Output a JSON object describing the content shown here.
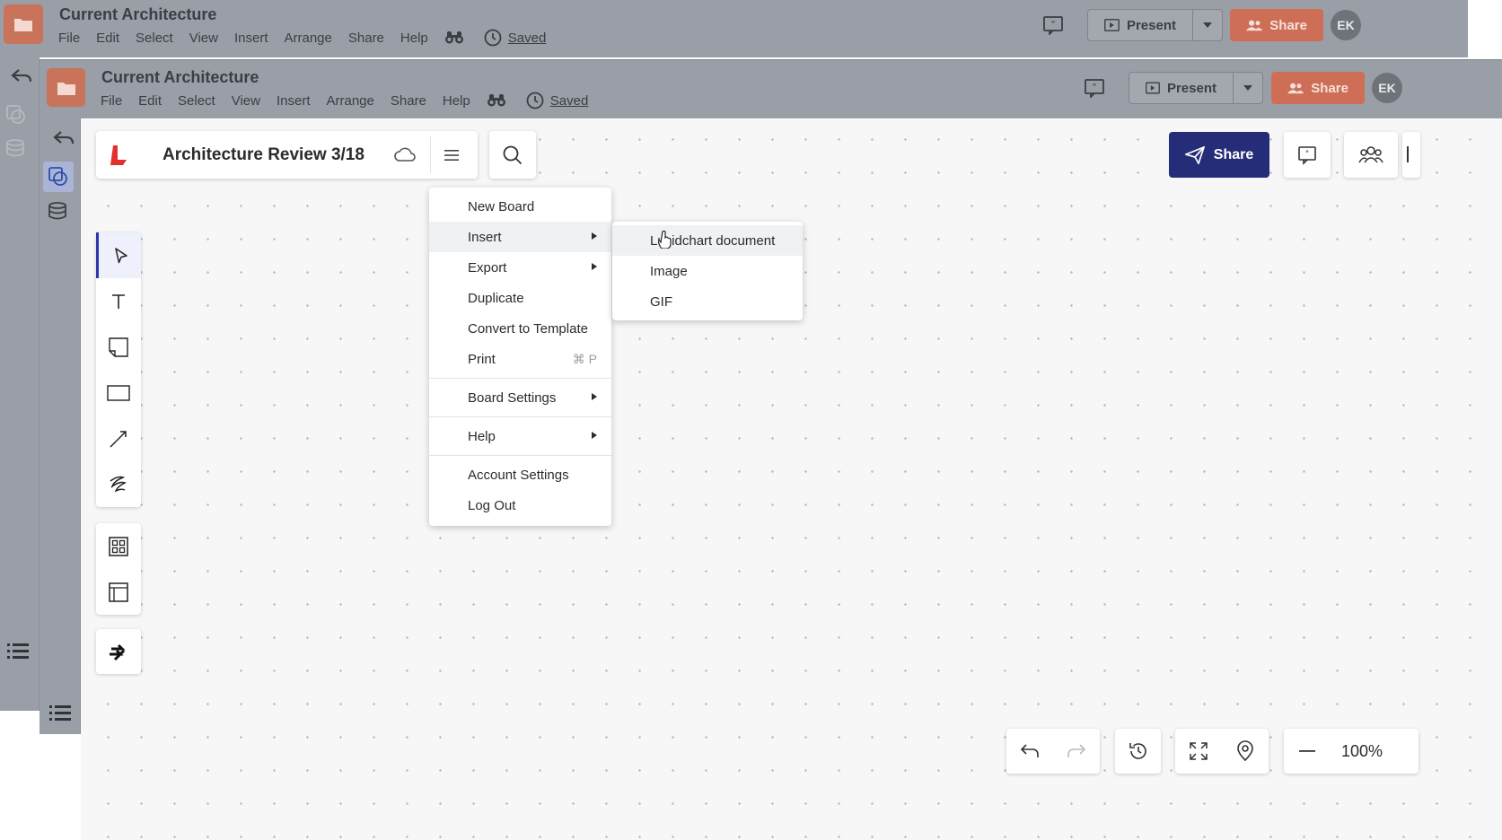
{
  "outer_window": {
    "title": "Current Architecture",
    "menu": [
      "File",
      "Edit",
      "Select",
      "View",
      "Insert",
      "Arrange",
      "Share",
      "Help"
    ],
    "saved_label": "Saved",
    "present_label": "Present",
    "share_label": "Share",
    "avatar_initials": "EK"
  },
  "inner_window": {
    "title": "Current Architecture",
    "menu": [
      "File",
      "Edit",
      "Select",
      "View",
      "Insert",
      "Arrange",
      "Share",
      "Help"
    ],
    "saved_label": "Saved",
    "present_label": "Present",
    "share_label": "Share",
    "avatar_initials": "EK"
  },
  "board": {
    "title": "Architecture Review 3/18",
    "share_label": "Share",
    "zoom_level": "100%"
  },
  "main_menu": {
    "items": [
      {
        "label": "New Board"
      },
      {
        "label": "Insert"
      },
      {
        "label": "Export"
      },
      {
        "label": "Duplicate"
      },
      {
        "label": "Convert to Template"
      },
      {
        "label": "Print",
        "shortcut": "⌘ P"
      },
      {
        "label": "Board Settings"
      },
      {
        "label": "Help"
      },
      {
        "label": "Account Settings"
      },
      {
        "label": "Log Out"
      }
    ]
  },
  "insert_submenu": {
    "items": [
      {
        "label": "Lucidchart document"
      },
      {
        "label": "Image"
      },
      {
        "label": "GIF"
      }
    ]
  },
  "tools": [
    "select-tool",
    "text-tool",
    "sticky-note-tool",
    "rectangle-tool",
    "line-tool",
    "pen-tool",
    "templates-tool",
    "frame-tool",
    "integrations-tool"
  ],
  "colors": {
    "chrome_gray": "#9a9ea6",
    "orange_share": "#cf6e56",
    "navy_share": "#262d78",
    "active_tool": "#2d37a8",
    "logo_red": "#e0322d"
  }
}
